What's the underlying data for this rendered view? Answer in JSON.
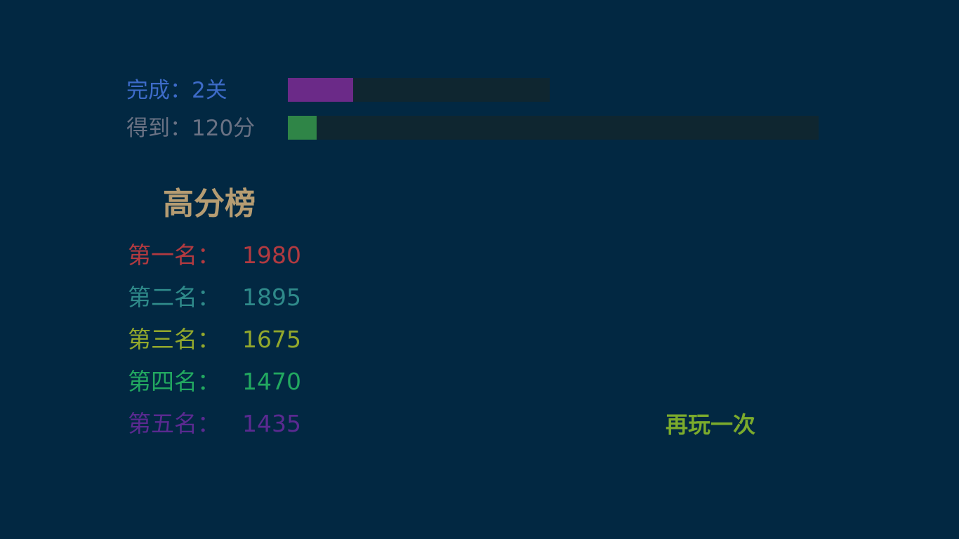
{
  "stats": {
    "levels_label": "完成：2关",
    "levels_progress": 0.25,
    "score_label": "得到：120分",
    "score_progress": 0.054,
    "levels_color": "#6b2a88",
    "score_color": "#2f8547"
  },
  "leaderboard": {
    "title": "高分榜",
    "entries": [
      {
        "rank_label": "第一名：",
        "score": "1980",
        "color": "#b23a40"
      },
      {
        "rank_label": "第二名：",
        "score": "1895",
        "color": "#2f8a8a"
      },
      {
        "rank_label": "第三名：",
        "score": "1675",
        "color": "#93a82c"
      },
      {
        "rank_label": "第四名：",
        "score": "1470",
        "color": "#22a860"
      },
      {
        "rank_label": "第五名：",
        "score": "1435",
        "color": "#5a2a90"
      }
    ]
  },
  "actions": {
    "replay_label": "再玩一次"
  }
}
